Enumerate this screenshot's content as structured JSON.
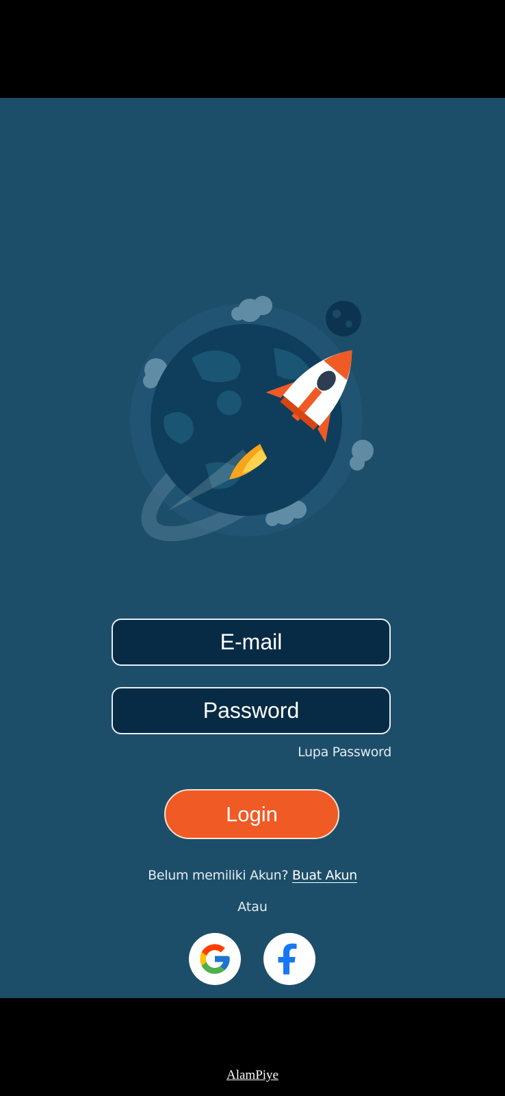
{
  "login_form": {
    "email_label": "E-mail",
    "password_label": "Password",
    "forgot_password": "Lupa Password",
    "login_button": "Login"
  },
  "register": {
    "prompt": "Belum memiliki Akun?",
    "link": "Buat Akun"
  },
  "divider_text": "Atau",
  "social_login": [
    {
      "name": "Google",
      "icon": "google-icon"
    },
    {
      "name": "Facebook",
      "icon": "facebook-icon"
    }
  ],
  "footer": {
    "brand": "AlamPiye"
  },
  "colors": {
    "background": "#1c4e69",
    "field_background": "#082b45",
    "accent": "#f05a24"
  }
}
